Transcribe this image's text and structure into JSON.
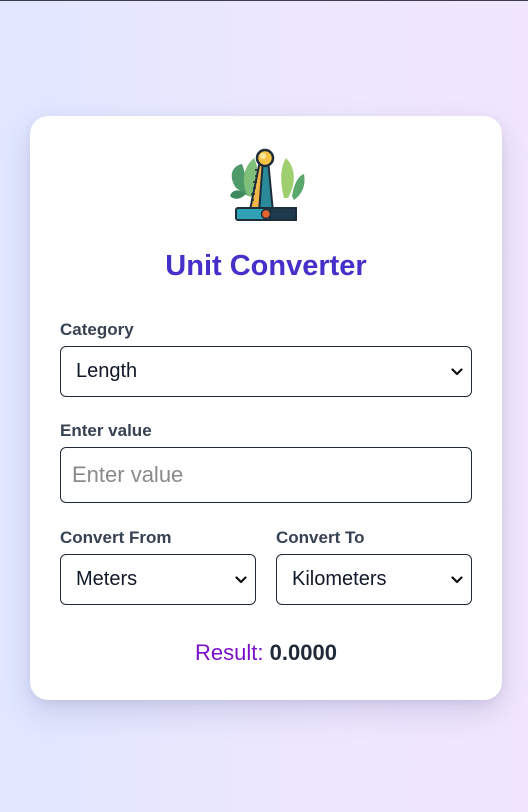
{
  "app": {
    "title": "Unit Converter",
    "logo_icon": "ruler-scale-icon"
  },
  "category": {
    "label": "Category",
    "selected": "Length"
  },
  "value": {
    "label": "Enter value",
    "placeholder": "Enter value",
    "current": ""
  },
  "from": {
    "label": "Convert From",
    "selected": "Meters"
  },
  "to": {
    "label": "Convert To",
    "selected": "Kilometers"
  },
  "result": {
    "label": "Result:",
    "value": "0.0000"
  },
  "colors": {
    "title": "#4530c9",
    "result_label": "#7a10c8",
    "background_start": "#e0e7ff",
    "background_end": "#f1e6fd"
  }
}
